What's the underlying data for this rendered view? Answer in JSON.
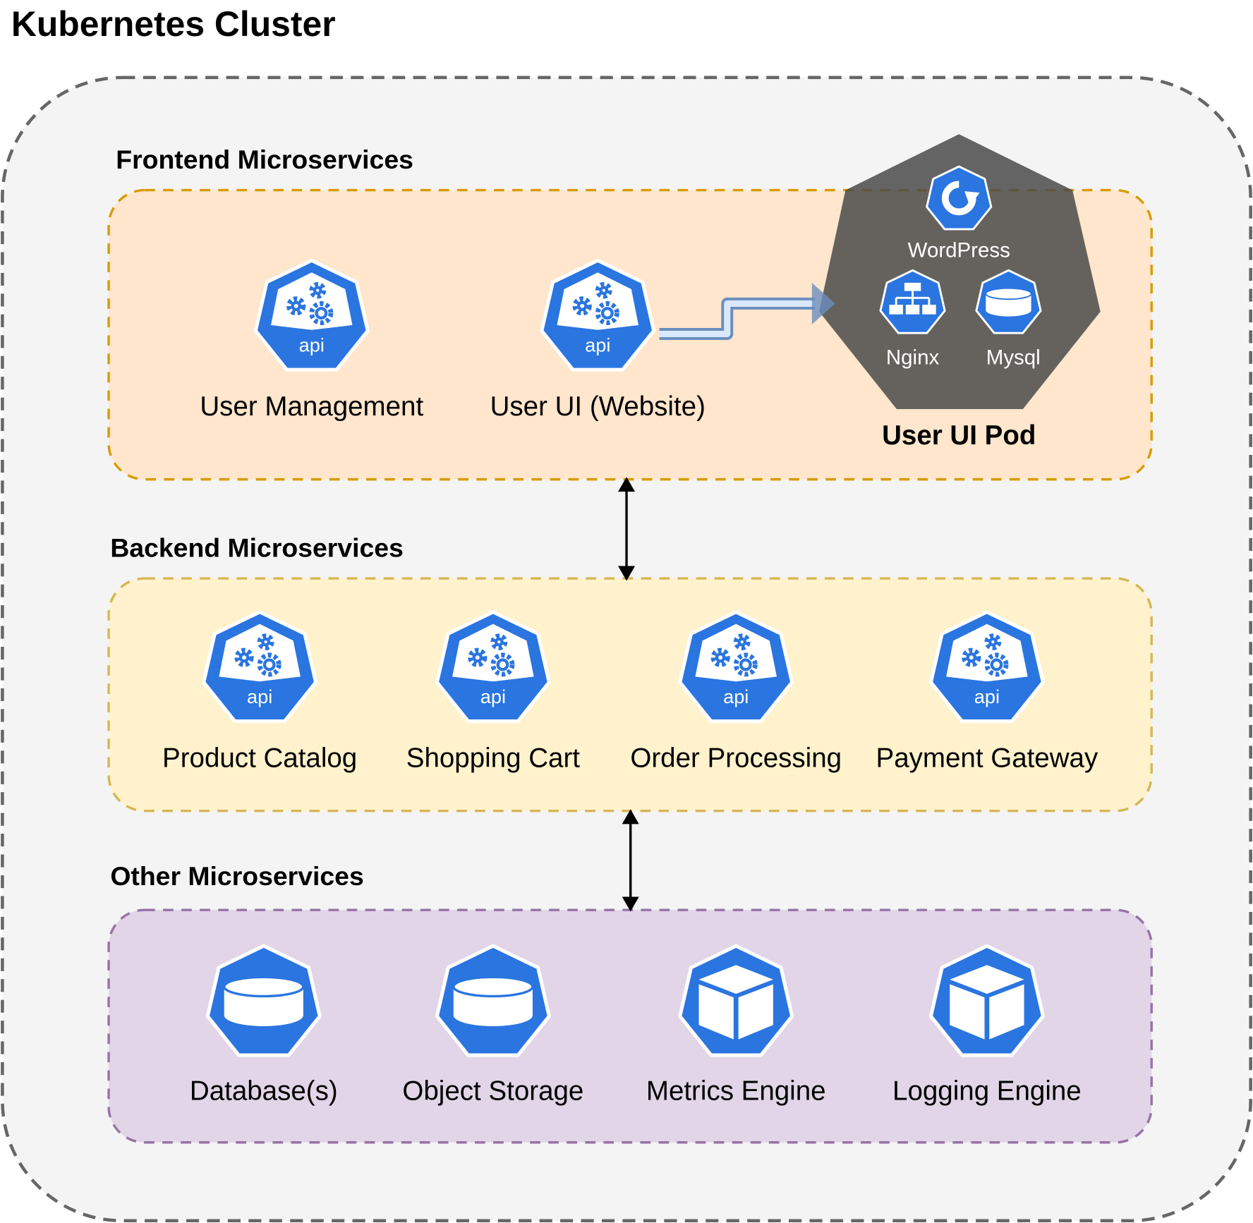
{
  "title": "Kubernetes Cluster",
  "colors": {
    "k8s_blue": "#2a75e0",
    "cluster_fill": "#f4f4f4",
    "cluster_stroke": "#666666",
    "frontend_fill": "#ffe6cc",
    "frontend_stroke": "#d79b00",
    "backend_fill": "#fff2cc",
    "backend_stroke": "#d6b656",
    "other_fill": "#e1d5e7",
    "other_stroke": "#9673a6",
    "pod_fill": "#5a5550",
    "arrow_fill": "#dae8fc",
    "arrow_stroke": "#6c8ebf"
  },
  "icons": {
    "api_label": "api"
  },
  "frontend": {
    "label": "Frontend Microservices",
    "nodes": [
      {
        "label": "User Management",
        "icon": "api-icon"
      },
      {
        "label": "User UI (Website)",
        "icon": "api-icon"
      }
    ],
    "pod": {
      "label": "User UI Pod",
      "components": [
        {
          "label": "WordPress",
          "icon": "deployment-icon"
        },
        {
          "label": "Nginx",
          "icon": "service-icon"
        },
        {
          "label": "Mysql",
          "icon": "volume-icon"
        }
      ]
    }
  },
  "backend": {
    "label": "Backend Microservices",
    "nodes": [
      {
        "label": "Product Catalog",
        "icon": "api-icon"
      },
      {
        "label": "Shopping Cart",
        "icon": "api-icon"
      },
      {
        "label": "Order Processing",
        "icon": "api-icon"
      },
      {
        "label": "Payment Gateway",
        "icon": "api-icon"
      }
    ]
  },
  "other": {
    "label": "Other Microservices",
    "nodes": [
      {
        "label": "Database(s)",
        "icon": "volume-icon"
      },
      {
        "label": "Object Storage",
        "icon": "volume-icon"
      },
      {
        "label": "Metrics Engine",
        "icon": "cube-icon"
      },
      {
        "label": "Logging Engine",
        "icon": "cube-icon"
      }
    ]
  }
}
